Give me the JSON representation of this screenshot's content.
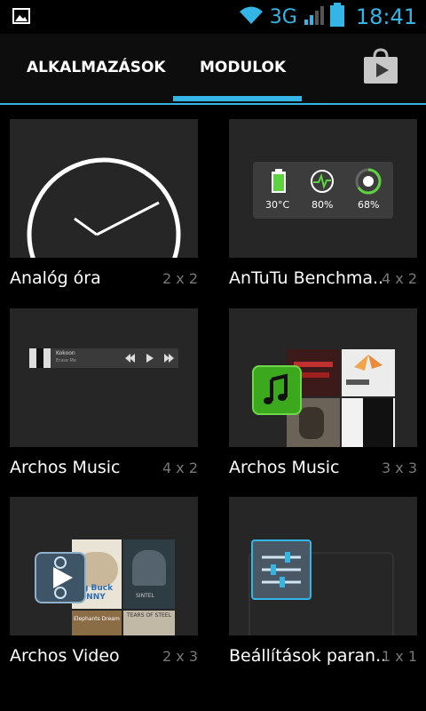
{
  "status": {
    "network": "3G",
    "time": "18:41"
  },
  "tabs": {
    "apps": "ALKALMAZÁSOK",
    "widgets": "MODULOK"
  },
  "widgets": [
    {
      "name": "Analóg óra",
      "size": "2 x 2"
    },
    {
      "name": "AnTuTu Benchma..",
      "size": "4 x 2",
      "stats": {
        "temp": "30°C",
        "cpu": "80%",
        "mem": "68%"
      }
    },
    {
      "name": "Archos Music",
      "size": "4 x 2",
      "track": {
        "title": "Kokoon",
        "artist": "Erase Me"
      }
    },
    {
      "name": "Archos Music",
      "size": "3 x 3"
    },
    {
      "name": "Archos Video",
      "size": "2 x 3",
      "posters": {
        "p1": "Big Buck BUNNY",
        "p2": "SINTEL",
        "p3": "Elephants Dream",
        "p4": "TEARS OF STEEL"
      }
    },
    {
      "name": "Beállítások paran..",
      "size": "1 x 1"
    }
  ],
  "colors": {
    "accent": "#33b5e5",
    "bg": "#000000",
    "tile": "#262626"
  }
}
